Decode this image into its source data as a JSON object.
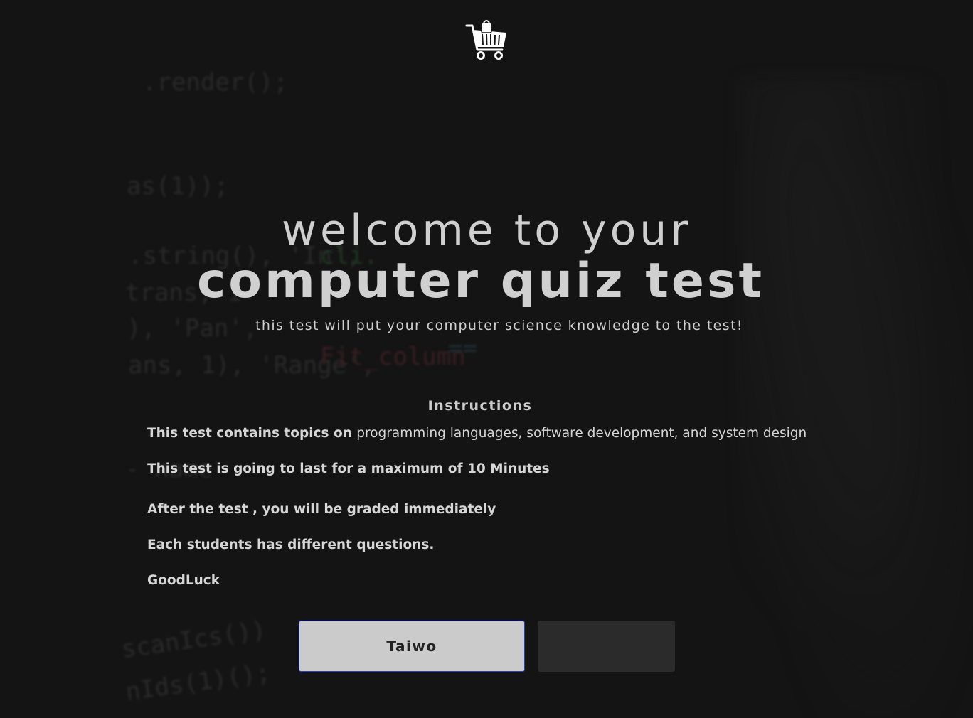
{
  "header": {
    "logo_icon": "shopping-cart-icon"
  },
  "hero": {
    "welcome": "welcome to your",
    "title": "computer quiz test",
    "subtitle": "this test will put your computer science knowledge to the test!"
  },
  "instructions": {
    "heading": "Instructions",
    "items": [
      {
        "bold": "This test contains topics on ",
        "normal": " programming languages, software development, and system design"
      },
      {
        "bold": "This test is going to last for a maximum of 10 Minutes",
        "normal": ""
      },
      {
        "bold": "After the test , you will be graded immediately",
        "normal": ""
      },
      {
        "bold": "Each students has different questions.",
        "normal": ""
      },
      {
        "bold": "GoodLuck",
        "normal": ""
      }
    ]
  },
  "form": {
    "name_value": "Taiwo",
    "start_label": ""
  },
  "colors": {
    "background": "#141414",
    "input_bg": "#cbcbcb",
    "input_border": "#2a3cc0",
    "button_bg": "#2b2b2b"
  }
}
